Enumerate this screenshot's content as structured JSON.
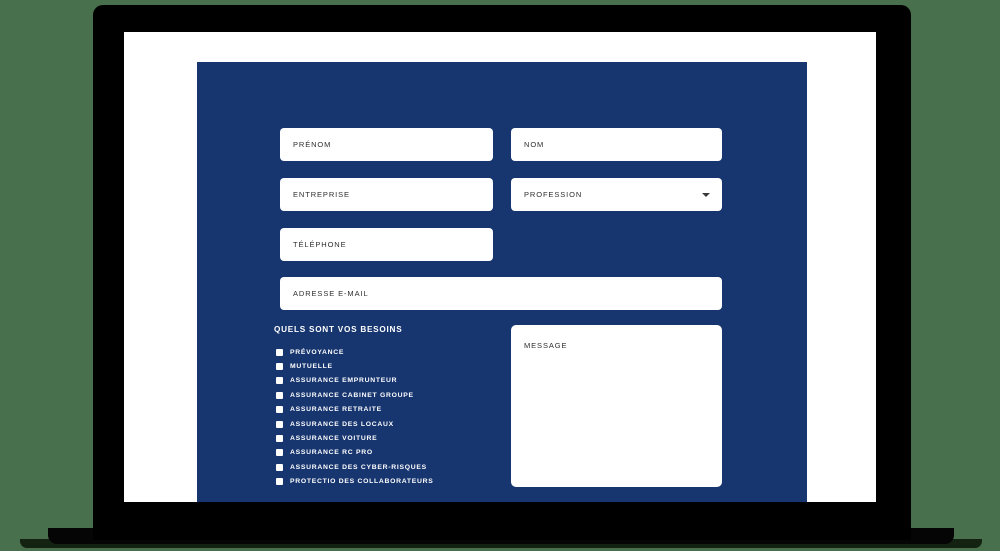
{
  "theme": {
    "background_green": "#49704c",
    "panel_navy": "#17356f",
    "bezel_black": "#000000",
    "page_white": "#ffffff",
    "field_text": "#2e2e2e"
  },
  "form": {
    "fields": [
      {
        "name": "prenom",
        "placeholder": "PRÉNOM",
        "type": "text"
      },
      {
        "name": "nom",
        "placeholder": "NOM",
        "type": "text"
      },
      {
        "name": "entreprise",
        "placeholder": "ENTREPRISE",
        "type": "text"
      },
      {
        "name": "profession",
        "placeholder": "PROFESSION",
        "type": "select"
      },
      {
        "name": "telephone",
        "placeholder": "TÉLÉPHONE",
        "type": "tel"
      },
      {
        "name": "email",
        "placeholder": "ADRESSE E-MAIL",
        "type": "email"
      }
    ],
    "needs_heading": "QUELS SONT VOS BESOINS",
    "needs_options": [
      "PRÉVOYANCE",
      "MUTUELLE",
      "ASSURANCE EMPRUNTEUR",
      "ASSURANCE CABINET GROUPE",
      "ASSURANCE RETRAITE",
      "ASSURANCE DES LOCAUX",
      "ASSURANCE VOITURE",
      "ASSURANCE RC PRO",
      "ASSURANCE DES CYBER-RISQUES",
      "PROTECTIO DES COLLABORATEURS"
    ],
    "message_placeholder": "MESSAGE"
  },
  "icons": {
    "select_caret": "chevron-down-icon",
    "checkbox": "checkbox-unchecked-icon"
  }
}
